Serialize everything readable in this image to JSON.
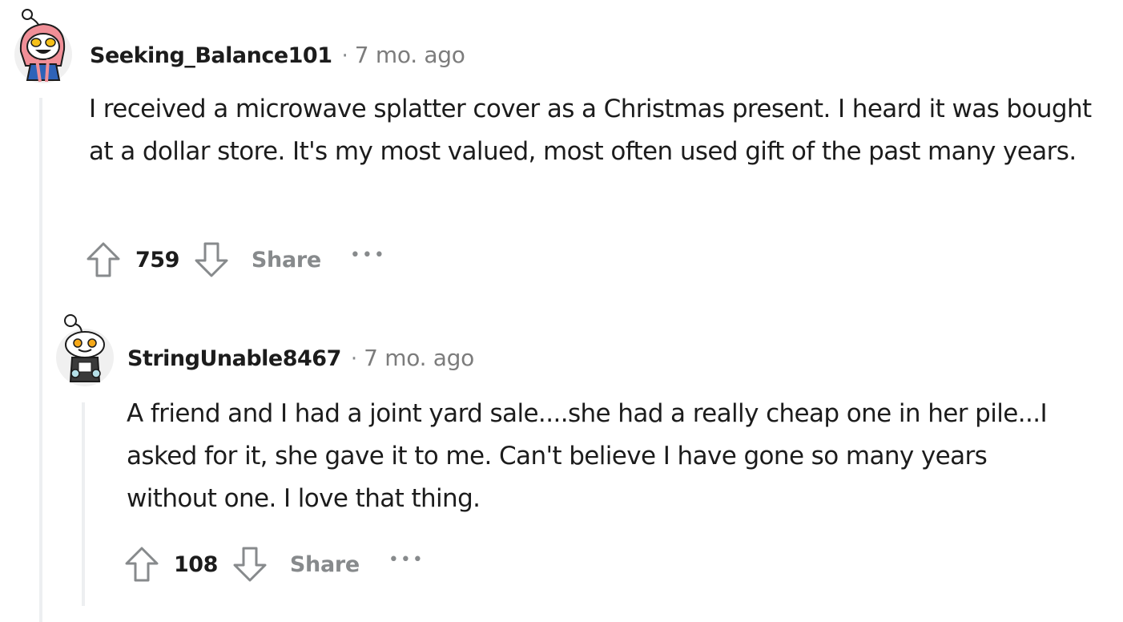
{
  "comments": [
    {
      "username": "Seeking_Balance101",
      "separator": "·",
      "time": "7 mo. ago",
      "body": "I received a microwave splatter cover as a Christmas present. I heard it was bought at a dollar store. It's my most valued, most often used gift of the past many years.",
      "score": "759",
      "share_label": "Share",
      "more_label": "•••",
      "avatar_colors": {
        "hood": "#f08f97",
        "face": "#ffffff",
        "eye": "#f5c018",
        "body": "#2e63b8"
      }
    },
    {
      "username": "StringUnable8467",
      "separator": "·",
      "time": "7 mo. ago",
      "body": "A friend and I had a joint yard sale....she had a really cheap one in her pile...I asked for it, she gave it to me. Can't believe I have gone so many years without one. I love that thing.",
      "score": "108",
      "share_label": "Share",
      "more_label": "•••",
      "avatar_colors": {
        "face": "#ffffff",
        "eye": "#f5a818",
        "body": "#3a3a3a"
      }
    }
  ],
  "colors": {
    "thread_line": "#edeff1",
    "meta_gray": "#878a8c",
    "text": "#1c1c1c"
  },
  "icons": {
    "upvote": "upvote-arrow-icon",
    "downvote": "downvote-arrow-icon"
  }
}
